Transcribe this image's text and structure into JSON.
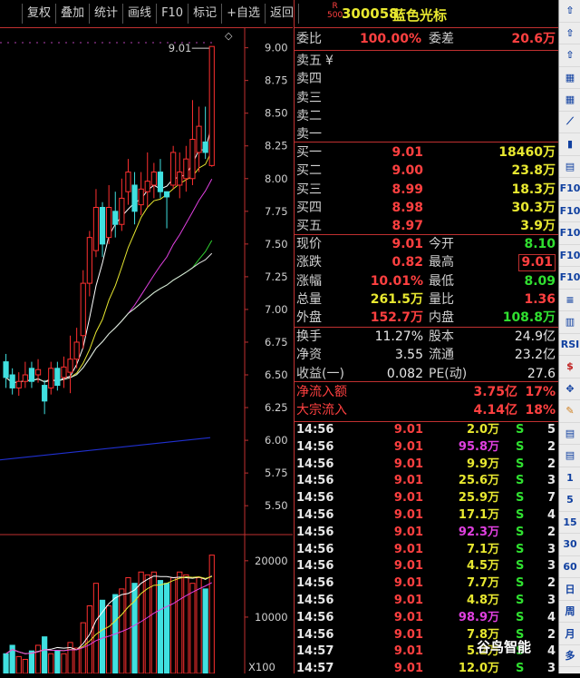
{
  "toolbar": {
    "buttons": [
      "复权",
      "叠加",
      "统计",
      "画线",
      "F10",
      "标记",
      "+自选",
      "返回"
    ]
  },
  "header": {
    "index_tag_top": "R",
    "index_tag_bottom": "500",
    "code": "300058",
    "name": "蓝色光标"
  },
  "weibi": {
    "label1": "委比",
    "value1": "100.00%",
    "label2": "委差",
    "value2": "20.6万"
  },
  "sell_levels": [
    {
      "label": "卖五",
      "price": "",
      "volume": "",
      "extra": "¥"
    },
    {
      "label": "卖四",
      "price": "",
      "volume": ""
    },
    {
      "label": "卖三",
      "price": "",
      "volume": ""
    },
    {
      "label": "卖二",
      "price": "",
      "volume": ""
    },
    {
      "label": "卖一",
      "price": "",
      "volume": ""
    }
  ],
  "buy_levels": [
    {
      "label": "买一",
      "price": "9.01",
      "volume": "18460万"
    },
    {
      "label": "买二",
      "price": "9.00",
      "volume": "23.8万"
    },
    {
      "label": "买三",
      "price": "8.99",
      "volume": "18.3万"
    },
    {
      "label": "买四",
      "price": "8.98",
      "volume": "30.3万"
    },
    {
      "label": "买五",
      "price": "8.97",
      "volume": "3.9万"
    }
  ],
  "quote": [
    {
      "l1": "现价",
      "v1": "9.01",
      "c1": "red",
      "l2": "今开",
      "v2": "8.10",
      "c2": "green"
    },
    {
      "l1": "涨跌",
      "v1": "0.82",
      "c1": "red",
      "l2": "最高",
      "v2": "9.01",
      "c2": "red"
    },
    {
      "l1": "涨幅",
      "v1": "10.01%",
      "c1": "red",
      "l2": "最低",
      "v2": "8.09",
      "c2": "green"
    },
    {
      "l1": "总量",
      "v1": "261.5万",
      "c1": "yellow",
      "l2": "量比",
      "v2": "1.36",
      "c2": "red"
    },
    {
      "l1": "外盘",
      "v1": "152.7万",
      "c1": "red",
      "l2": "内盘",
      "v2": "108.8万",
      "c2": "green"
    }
  ],
  "stats": [
    {
      "l1": "换手",
      "v1": "11.27%",
      "l2": "股本",
      "v2": "24.9亿"
    },
    {
      "l1": "净资",
      "v1": "3.55",
      "l2": "流通",
      "v2": "23.2亿"
    },
    {
      "l1": "收益(一)",
      "v1": "0.082",
      "l2": "PE(动)",
      "v2": "27.6"
    }
  ],
  "flow": [
    {
      "label": "净流入额",
      "value": "3.75亿",
      "pct": "17%"
    },
    {
      "label": "大宗流入",
      "value": "4.14亿",
      "pct": "18%"
    }
  ],
  "ticks": [
    {
      "time": "14:56",
      "price": "9.01",
      "vol": "2.0万",
      "color": "yellow",
      "side": "S",
      "n": "5"
    },
    {
      "time": "14:56",
      "price": "9.01",
      "vol": "95.8万",
      "color": "magenta",
      "side": "S",
      "n": "2"
    },
    {
      "time": "14:56",
      "price": "9.01",
      "vol": "9.9万",
      "color": "yellow",
      "side": "S",
      "n": "2"
    },
    {
      "time": "14:56",
      "price": "9.01",
      "vol": "25.6万",
      "color": "yellow",
      "side": "S",
      "n": "3"
    },
    {
      "time": "14:56",
      "price": "9.01",
      "vol": "25.9万",
      "color": "yellow",
      "side": "S",
      "n": "7"
    },
    {
      "time": "14:56",
      "price": "9.01",
      "vol": "17.1万",
      "color": "yellow",
      "side": "S",
      "n": "4"
    },
    {
      "time": "14:56",
      "price": "9.01",
      "vol": "92.3万",
      "color": "magenta",
      "side": "S",
      "n": "2"
    },
    {
      "time": "14:56",
      "price": "9.01",
      "vol": "7.1万",
      "color": "yellow",
      "side": "S",
      "n": "3"
    },
    {
      "time": "14:56",
      "price": "9.01",
      "vol": "4.5万",
      "color": "yellow",
      "side": "S",
      "n": "3"
    },
    {
      "time": "14:56",
      "price": "9.01",
      "vol": "7.7万",
      "color": "yellow",
      "side": "S",
      "n": "2"
    },
    {
      "time": "14:56",
      "price": "9.01",
      "vol": "4.8万",
      "color": "yellow",
      "side": "S",
      "n": "3"
    },
    {
      "time": "14:56",
      "price": "9.01",
      "vol": "98.9万",
      "color": "magenta",
      "side": "S",
      "n": "4"
    },
    {
      "time": "14:56",
      "price": "9.01",
      "vol": "7.8万",
      "color": "yellow",
      "side": "S",
      "n": "2"
    },
    {
      "time": "14:57",
      "price": "9.01",
      "vol": "5.2万",
      "color": "yellow",
      "side": "S",
      "n": "4"
    },
    {
      "time": "14:57",
      "price": "9.01",
      "vol": "12.0万",
      "color": "yellow",
      "side": "S",
      "n": "3"
    }
  ],
  "chart_data": {
    "type": "candlestick",
    "price_axis": {
      "ticks": [
        "9.00",
        "8.75",
        "8.50",
        "8.25",
        "8.00",
        "7.75",
        "7.50",
        "7.25",
        "7.00",
        "6.75",
        "6.50",
        "6.25",
        "6.00",
        "5.75",
        "5.50"
      ],
      "ylim": [
        5.3,
        9.15
      ]
    },
    "volume_axis": {
      "ticks": [
        "20000",
        "10000"
      ],
      "unit": "X100"
    },
    "high_label": "9.01",
    "candles": [
      {
        "o": 6.6,
        "c": 6.48,
        "h": 6.66,
        "l": 6.4
      },
      {
        "o": 6.5,
        "c": 6.4,
        "h": 6.55,
        "l": 6.35
      },
      {
        "o": 6.4,
        "c": 6.45,
        "h": 6.52,
        "l": 6.34
      },
      {
        "o": 6.45,
        "c": 6.5,
        "h": 6.6,
        "l": 6.4
      },
      {
        "o": 6.55,
        "c": 6.45,
        "h": 6.6,
        "l": 6.4
      },
      {
        "o": 6.5,
        "c": 6.54,
        "h": 6.62,
        "l": 6.44
      },
      {
        "o": 6.42,
        "c": 6.3,
        "h": 6.46,
        "l": 6.2
      },
      {
        "o": 6.4,
        "c": 6.55,
        "h": 6.6,
        "l": 6.35
      },
      {
        "o": 6.55,
        "c": 6.42,
        "h": 6.6,
        "l": 6.38
      },
      {
        "o": 6.48,
        "c": 6.56,
        "h": 6.64,
        "l": 6.4
      },
      {
        "o": 6.52,
        "c": 6.62,
        "h": 6.8,
        "l": 6.36
      },
      {
        "o": 6.62,
        "c": 6.75,
        "h": 6.86,
        "l": 6.55
      },
      {
        "o": 6.8,
        "c": 7.2,
        "h": 7.3,
        "l": 6.7
      },
      {
        "o": 7.2,
        "c": 7.55,
        "h": 7.6,
        "l": 7.1
      },
      {
        "o": 7.45,
        "c": 7.78,
        "h": 7.92,
        "l": 7.4
      },
      {
        "o": 7.78,
        "c": 7.5,
        "h": 7.82,
        "l": 7.4
      },
      {
        "o": 7.55,
        "c": 7.78,
        "h": 7.95,
        "l": 7.5
      },
      {
        "o": 7.75,
        "c": 7.65,
        "h": 7.9,
        "l": 7.55
      },
      {
        "o": 7.65,
        "c": 7.85,
        "h": 8.0,
        "l": 7.6
      },
      {
        "o": 7.9,
        "c": 8.05,
        "h": 8.15,
        "l": 7.8
      },
      {
        "o": 7.95,
        "c": 7.75,
        "h": 8.05,
        "l": 7.65
      },
      {
        "o": 7.8,
        "c": 7.92,
        "h": 8.05,
        "l": 7.72
      },
      {
        "o": 7.9,
        "c": 7.98,
        "h": 8.2,
        "l": 7.78
      },
      {
        "o": 7.95,
        "c": 8.05,
        "h": 8.12,
        "l": 7.85
      },
      {
        "o": 8.05,
        "c": 7.9,
        "h": 8.15,
        "l": 7.85
      },
      {
        "o": 7.9,
        "c": 7.86,
        "h": 7.9,
        "l": 7.62
      },
      {
        "o": 7.95,
        "c": 8.2,
        "h": 8.25,
        "l": 7.92
      },
      {
        "o": 7.95,
        "c": 8.05,
        "h": 8.2,
        "l": 7.85
      },
      {
        "o": 8.0,
        "c": 8.15,
        "h": 8.25,
        "l": 7.9
      },
      {
        "o": 8.0,
        "c": 8.3,
        "h": 8.6,
        "l": 7.95
      },
      {
        "o": 8.2,
        "c": 8.4,
        "h": 8.55,
        "l": 8.05
      },
      {
        "o": 8.28,
        "c": 8.2,
        "h": 8.55,
        "l": 8.15
      },
      {
        "o": 8.1,
        "c": 9.01,
        "h": 9.01,
        "l": 8.09
      }
    ],
    "volumes": [
      3500,
      5000,
      3000,
      2500,
      4000,
      5000,
      6500,
      3500,
      4000,
      3500,
      5500,
      4500,
      9000,
      12000,
      16000,
      13000,
      12000,
      14000,
      15000,
      17000,
      16000,
      18000,
      17500,
      18000,
      16500,
      16000,
      17000,
      18000,
      17500,
      16000,
      17000,
      15000,
      21000
    ]
  },
  "sidebar_icons": [
    "up-arrow",
    "up-arrow",
    "up-arrow",
    "grid",
    "grid",
    "line",
    "bars",
    "doc",
    "F10",
    "F10",
    "F10",
    "F10",
    "F10",
    "list",
    "chart",
    "RSI",
    "money",
    "move",
    "pencil",
    "doc",
    "doc",
    "1",
    "5",
    "15",
    "30",
    "60",
    "日",
    "周",
    "月",
    "多"
  ]
}
